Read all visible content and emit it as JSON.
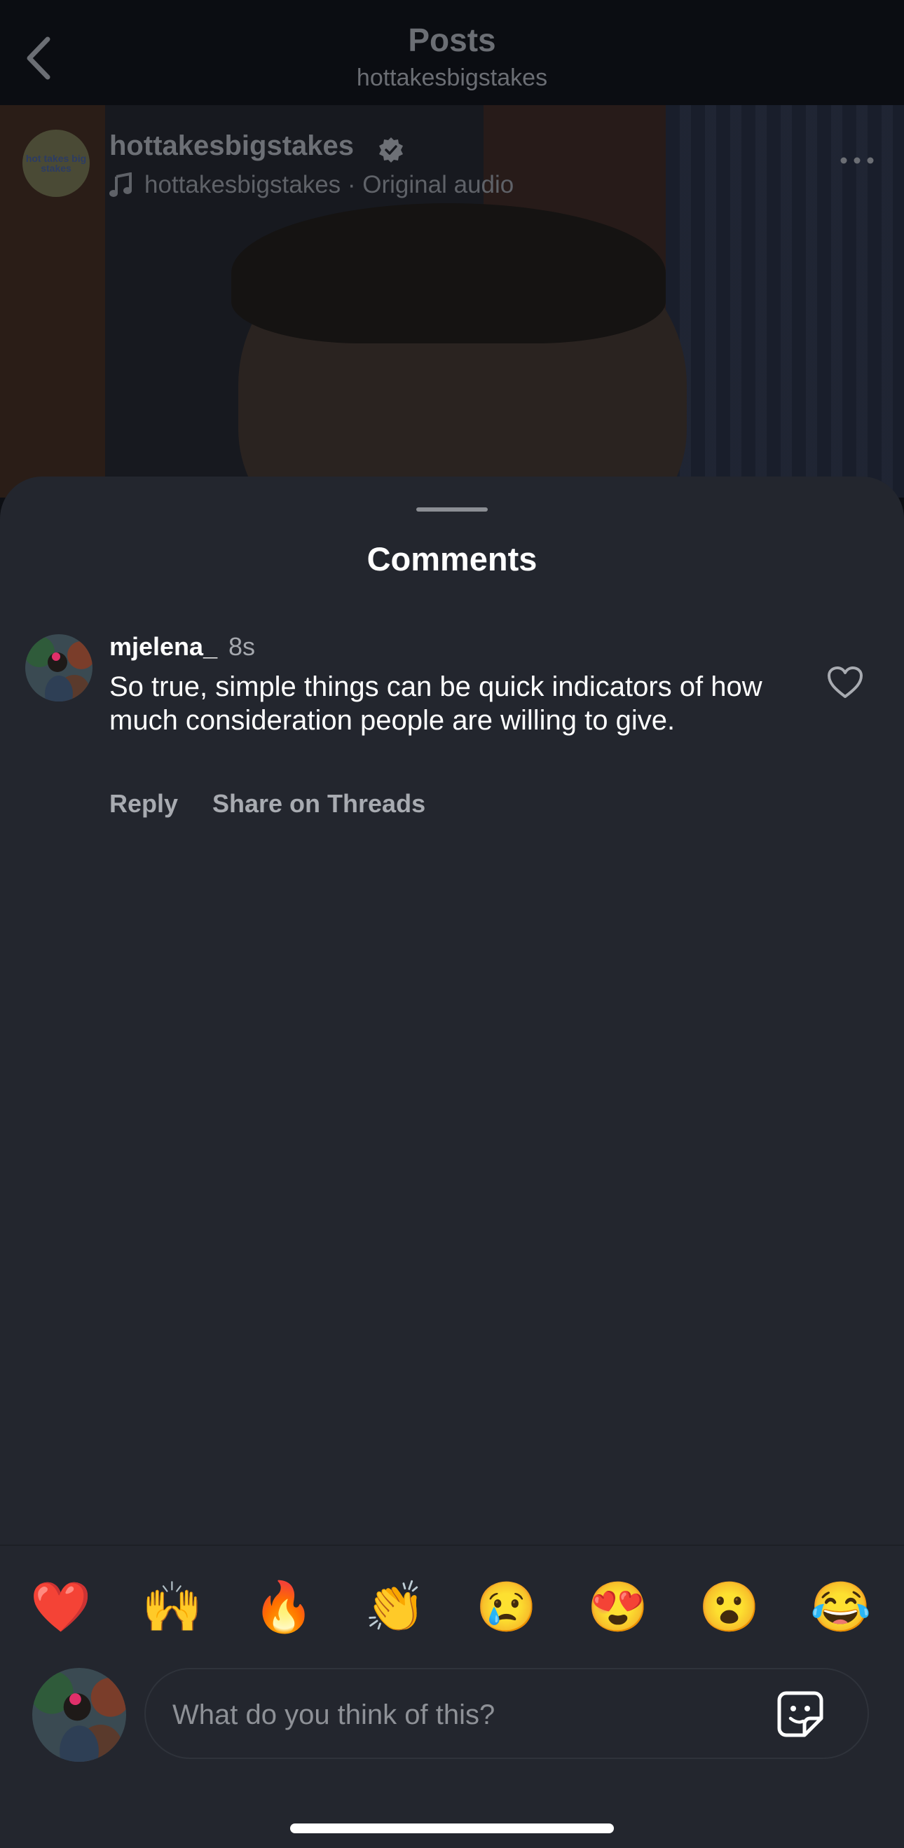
{
  "header": {
    "title": "Posts",
    "subtitle": "hottakesbigstakes"
  },
  "post": {
    "avatar_text": "hot takes big stakes",
    "username": "hottakesbigstakes",
    "audio": "hottakesbigstakes · Original audio"
  },
  "sheet": {
    "title": "Comments"
  },
  "comments": [
    {
      "username": "mjelena_",
      "time": "8s",
      "text": "So true, simple things can be quick indicators of how much consideration people are willing to give.",
      "reply_label": "Reply",
      "share_label": "Share on Threads"
    }
  ],
  "reactions": [
    "❤️",
    "🙌",
    "🔥",
    "👏",
    "😢",
    "😍",
    "😮",
    "😂"
  ],
  "composer": {
    "placeholder": "What do you think of this?",
    "value": ""
  },
  "colors": {
    "sheet_bg": "#23262e",
    "secondary_text": "#a8abb1"
  }
}
